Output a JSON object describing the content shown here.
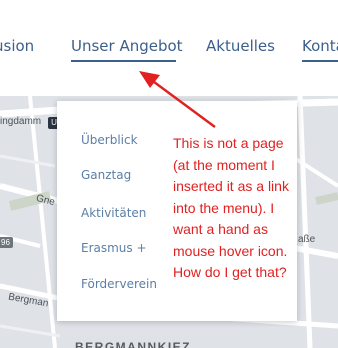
{
  "nav": {
    "items": [
      {
        "label": "usion"
      },
      {
        "label": "Unser Angebot"
      },
      {
        "label": "Aktuelles"
      },
      {
        "label": "Konta"
      }
    ]
  },
  "map": {
    "labels": {
      "damm": "ingdamm",
      "gne": "Gne",
      "bergman": "Bergman",
      "strasse": "aße",
      "kiez": "BERGMANNKIEZ",
      "road_badge": "96",
      "u_badge": "U"
    }
  },
  "dropdown": {
    "items": [
      {
        "label": "Überblick"
      },
      {
        "label": "Ganztag"
      },
      {
        "label": "Aktivitäten"
      },
      {
        "label": "Erasmus +"
      },
      {
        "label": "Förderverein"
      }
    ]
  },
  "annotation": {
    "lines": [
      "This is not a page",
      "(at the moment I",
      "inserted it as a link",
      "into the menu). I",
      "want a hand as",
      "mouse hover icon.",
      "How do I get that?"
    ]
  },
  "colors": {
    "nav_text": "#3d5f8c",
    "dropdown_text": "#5b7fa6",
    "annotation": "#e12121",
    "map_bg": "#dfe3e8"
  }
}
